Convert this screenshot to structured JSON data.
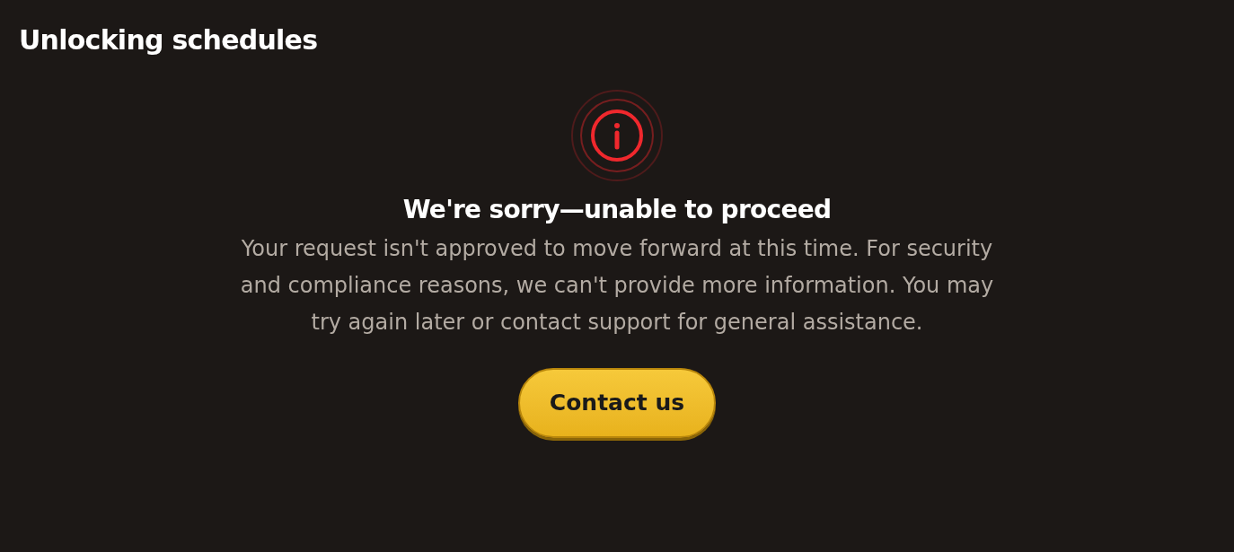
{
  "page": {
    "title": "Unlocking schedules"
  },
  "message": {
    "heading": "We're sorry—unable to proceed",
    "body": "Your request isn't approved to move forward at this time. For security and compliance reasons, we can't provide more information. You may try again later or contact support for general assistance."
  },
  "buttons": [
    "Contact us"
  ]
}
